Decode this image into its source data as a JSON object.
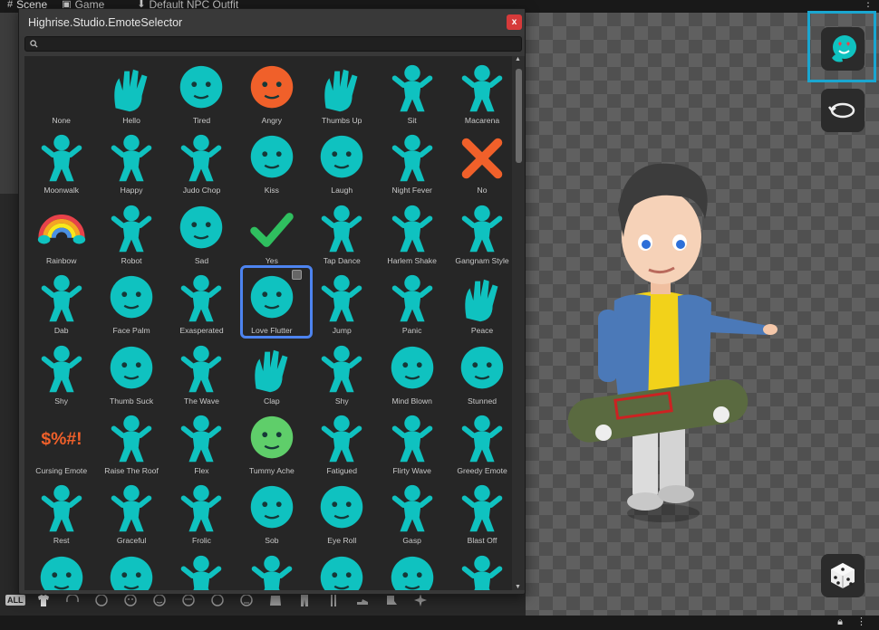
{
  "unity_tabs": [
    {
      "icon": "#",
      "label": "Scene"
    },
    {
      "icon": "▣",
      "label": "Game"
    },
    {
      "icon": "⬇",
      "label": "Default NPC Outfit"
    }
  ],
  "popup": {
    "title": "Highrise.Studio.EmoteSelector",
    "close_label": "x",
    "search_value": "",
    "selected": "Love Flutter"
  },
  "emotes": [
    {
      "label": "None",
      "kind": "none",
      "color": "#00b3b3"
    },
    {
      "label": "Hello",
      "kind": "hand",
      "color": "#0fc2c0"
    },
    {
      "label": "Tired",
      "kind": "face",
      "color": "#0fc2c0"
    },
    {
      "label": "Angry",
      "kind": "face",
      "color": "#f0602a"
    },
    {
      "label": "Thumbs Up",
      "kind": "hand",
      "color": "#0fc2c0"
    },
    {
      "label": "Sit",
      "kind": "body",
      "color": "#0fc2c0"
    },
    {
      "label": "Macarena",
      "kind": "body",
      "color": "#0fc2c0"
    },
    {
      "label": "Moonwalk",
      "kind": "body",
      "color": "#0fc2c0"
    },
    {
      "label": "Happy",
      "kind": "body",
      "color": "#0fc2c0"
    },
    {
      "label": "Judo Chop",
      "kind": "body",
      "color": "#0fc2c0"
    },
    {
      "label": "Kiss",
      "kind": "face",
      "color": "#0fc2c0"
    },
    {
      "label": "Laugh",
      "kind": "face",
      "color": "#0fc2c0"
    },
    {
      "label": "Night Fever",
      "kind": "body",
      "color": "#0fc2c0"
    },
    {
      "label": "No",
      "kind": "cross",
      "color": "#f0602a"
    },
    {
      "label": "Rainbow",
      "kind": "rainbow",
      "color": "#0fc2c0"
    },
    {
      "label": "Robot",
      "kind": "body",
      "color": "#0fc2c0"
    },
    {
      "label": "Sad",
      "kind": "face",
      "color": "#0fc2c0"
    },
    {
      "label": "Yes",
      "kind": "check",
      "color": "#2fbf5f"
    },
    {
      "label": "Tap Dance",
      "kind": "body",
      "color": "#0fc2c0"
    },
    {
      "label": "Harlem Shake",
      "kind": "body",
      "color": "#0fc2c0"
    },
    {
      "label": "Gangnam Style",
      "kind": "body",
      "color": "#0fc2c0"
    },
    {
      "label": "Dab",
      "kind": "body",
      "color": "#0fc2c0"
    },
    {
      "label": "Face Palm",
      "kind": "face",
      "color": "#0fc2c0"
    },
    {
      "label": "Exasperated",
      "kind": "body",
      "color": "#0fc2c0"
    },
    {
      "label": "Love Flutter",
      "kind": "face",
      "color": "#0fc2c0"
    },
    {
      "label": "Jump",
      "kind": "body",
      "color": "#0fc2c0"
    },
    {
      "label": "Panic",
      "kind": "body",
      "color": "#0fc2c0"
    },
    {
      "label": "Peace",
      "kind": "hand",
      "color": "#0fc2c0"
    },
    {
      "label": "Shy",
      "kind": "body",
      "color": "#0fc2c0"
    },
    {
      "label": "Thumb Suck",
      "kind": "face",
      "color": "#0fc2c0"
    },
    {
      "label": "The Wave",
      "kind": "body",
      "color": "#0fc2c0"
    },
    {
      "label": "Clap",
      "kind": "hand",
      "color": "#0fc2c0"
    },
    {
      "label": "Shy",
      "kind": "body",
      "color": "#0fc2c0"
    },
    {
      "label": "Mind Blown",
      "kind": "face",
      "color": "#0fc2c0"
    },
    {
      "label": "Stunned",
      "kind": "face",
      "color": "#0fc2c0"
    },
    {
      "label": "Cursing Emote",
      "kind": "text",
      "color": "#f0602a"
    },
    {
      "label": "Raise The Roof",
      "kind": "body",
      "color": "#0fc2c0"
    },
    {
      "label": "Flex",
      "kind": "body",
      "color": "#0fc2c0"
    },
    {
      "label": "Tummy Ache",
      "kind": "face",
      "color": "#5fce6a"
    },
    {
      "label": "Fatigued",
      "kind": "body",
      "color": "#0fc2c0"
    },
    {
      "label": "Flirty Wave",
      "kind": "body",
      "color": "#0fc2c0"
    },
    {
      "label": "Greedy Emote",
      "kind": "body",
      "color": "#0fc2c0"
    },
    {
      "label": "Rest",
      "kind": "body",
      "color": "#0fc2c0"
    },
    {
      "label": "Graceful",
      "kind": "body",
      "color": "#0fc2c0"
    },
    {
      "label": "Frolic",
      "kind": "body",
      "color": "#0fc2c0"
    },
    {
      "label": "Sob",
      "kind": "face",
      "color": "#0fc2c0"
    },
    {
      "label": "Eye Roll",
      "kind": "face",
      "color": "#0fc2c0"
    },
    {
      "label": "Gasp",
      "kind": "body",
      "color": "#0fc2c0"
    },
    {
      "label": "Blast Off",
      "kind": "body",
      "color": "#0fc2c0"
    },
    {
      "label": "",
      "kind": "face",
      "color": "#0fc2c0"
    },
    {
      "label": "",
      "kind": "face",
      "color": "#0fc2c0"
    },
    {
      "label": "",
      "kind": "body",
      "color": "#0fc2c0"
    },
    {
      "label": "",
      "kind": "body",
      "color": "#0fc2c0"
    },
    {
      "label": "",
      "kind": "face",
      "color": "#0fc2c0"
    },
    {
      "label": "",
      "kind": "face",
      "color": "#0fc2c0"
    },
    {
      "label": "",
      "kind": "body",
      "color": "#0fc2c0"
    }
  ],
  "category_bar": {
    "all_label": "ALL",
    "icons": [
      "shirt-icon",
      "hair-icon",
      "face-icon",
      "face-icon",
      "face-icon",
      "face-icon",
      "face-icon",
      "face-icon",
      "top-icon",
      "pants-icon",
      "legs-icon",
      "shoes-icon",
      "accessory-icon",
      "sparkle-icon"
    ]
  },
  "toolbar": {
    "emote_button_icon": "emote-icon",
    "rotate_button_icon": "rotate-icon",
    "random_button_icon": "dice-icon"
  },
  "colors": {
    "accent": "#1aa6d0",
    "selection": "#4d84f0",
    "close": "#d63a3a",
    "emote_teal": "#0fc2c0"
  }
}
